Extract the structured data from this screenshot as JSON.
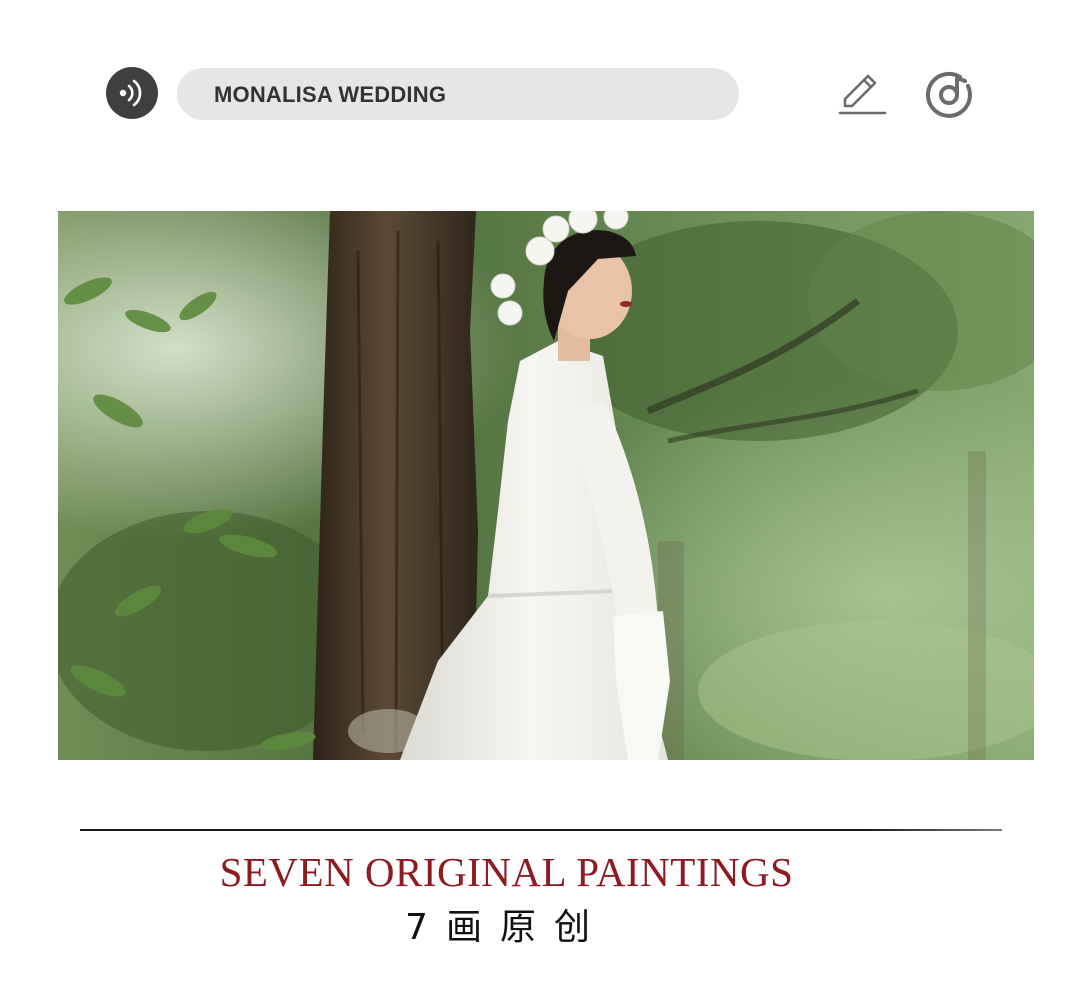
{
  "header": {
    "search_text": "MONALISA WEDDING",
    "icons": {
      "audio": "audio-wave-icon",
      "edit": "pencil-edit-icon",
      "music": "music-disc-icon"
    }
  },
  "hero": {
    "image": "bride-in-forest-photo",
    "colors": {
      "foliage": "#5d7a4a",
      "dress": "#f4f3ef",
      "trunk": "#4a3a2a"
    }
  },
  "caption": {
    "title_en": "SEVEN ORIGINAL PAINTINGS",
    "title_cn": "7画原创",
    "title_color": "#8e1a22"
  }
}
